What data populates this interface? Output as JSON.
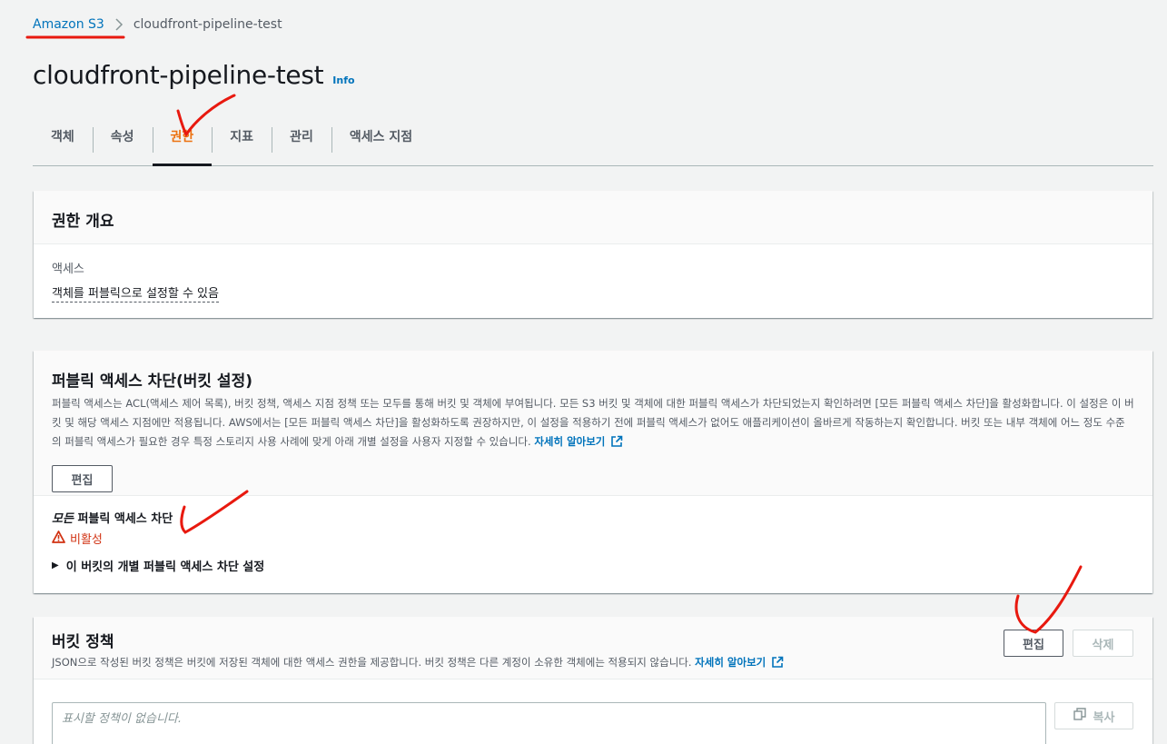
{
  "breadcrumb": {
    "root": "Amazon S3",
    "current": "cloudfront-pipeline-test"
  },
  "header": {
    "title": "cloudfront-pipeline-test",
    "info": "Info"
  },
  "tabs": [
    {
      "label": "객체"
    },
    {
      "label": "속성"
    },
    {
      "label": "권한",
      "active": true
    },
    {
      "label": "지표"
    },
    {
      "label": "관리"
    },
    {
      "label": "액세스 지점"
    }
  ],
  "overview": {
    "title": "권한 개요",
    "access_label": "액세스",
    "access_value": "객체를 퍼블릭으로 설정할 수 있음"
  },
  "public_access": {
    "title": "퍼블릭 액세스 차단(버킷 설정)",
    "description": "퍼블릭 액세스는 ACL(액세스 제어 목록), 버킷 정책, 액세스 지점 정책 또는 모두를 통해 버킷 및 객체에 부여됩니다. 모든 S3 버킷 및 객체에 대한 퍼블릭 액세스가 차단되었는지 확인하려면 [모든 퍼블릭 액세스 차단]을 활성화합니다. 이 설정은 이 버킷 및 해당 액세스 지점에만 적용됩니다. AWS에서는 [모든 퍼블릭 액세스 차단]을 활성화하도록 권장하지만, 이 설정을 적용하기 전에 퍼블릭 액세스가 없어도 애플리케이션이 올바르게 작동하는지 확인합니다. 버킷 또는 내부 객체에 어느 정도 수준의 퍼블릭 액세스가 필요한 경우 특정 스토리지 사용 사례에 맞게 아래 개별 설정을 사용자 지정할 수 있습니다.",
    "learn_more": "자세히 알아보기",
    "edit_button": "편집",
    "block_all_prefix": "모든",
    "block_all_suffix": "퍼블릭 액세스 차단",
    "status": "비활성",
    "expander": "이 버킷의 개별 퍼블릭 액세스 차단 설정"
  },
  "bucket_policy": {
    "title": "버킷 정책",
    "description": "JSON으로 작성된 버킷 정책은 버킷에 저장된 객체에 대한 액세스 권한을 제공합니다. 버킷 정책은 다른 계정이 소유한 객체에는 적용되지 않습니다.",
    "learn_more": "자세히 알아보기",
    "edit_button": "편집",
    "delete_button": "삭제",
    "empty_text": "표시할 정책이 없습니다.",
    "copy_button": "복사"
  },
  "colors": {
    "link": "#0073bb",
    "active_tab": "#ec7211",
    "warning": "#d13212",
    "annotation": "#e8190f"
  }
}
